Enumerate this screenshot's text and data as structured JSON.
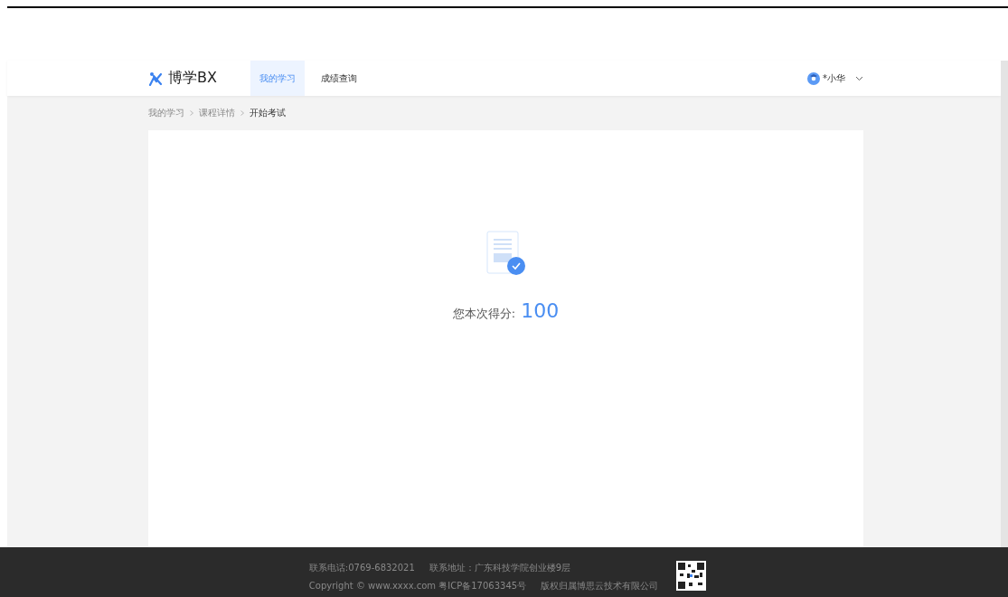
{
  "header": {
    "logo": "博学BX",
    "tabs": [
      {
        "label": "我的学习",
        "selected": true
      },
      {
        "label": "成绩查询",
        "selected": false
      }
    ],
    "user": "*小华"
  },
  "breadcrumb": [
    {
      "label": "我的学习",
      "current": false
    },
    {
      "label": "课程详情",
      "current": false
    },
    {
      "label": "开始考试",
      "current": true
    }
  ],
  "result": {
    "label": "您本次得分:",
    "score": "100"
  },
  "footer": {
    "phone": "联系电话:0769-6832021",
    "address": "联系地址：广东科技学院创业楼9层",
    "copyright": "Copyright © www.xxxx.com 粤ICP备17063345号",
    "rights": "版权归属博思云技术有限公司"
  }
}
